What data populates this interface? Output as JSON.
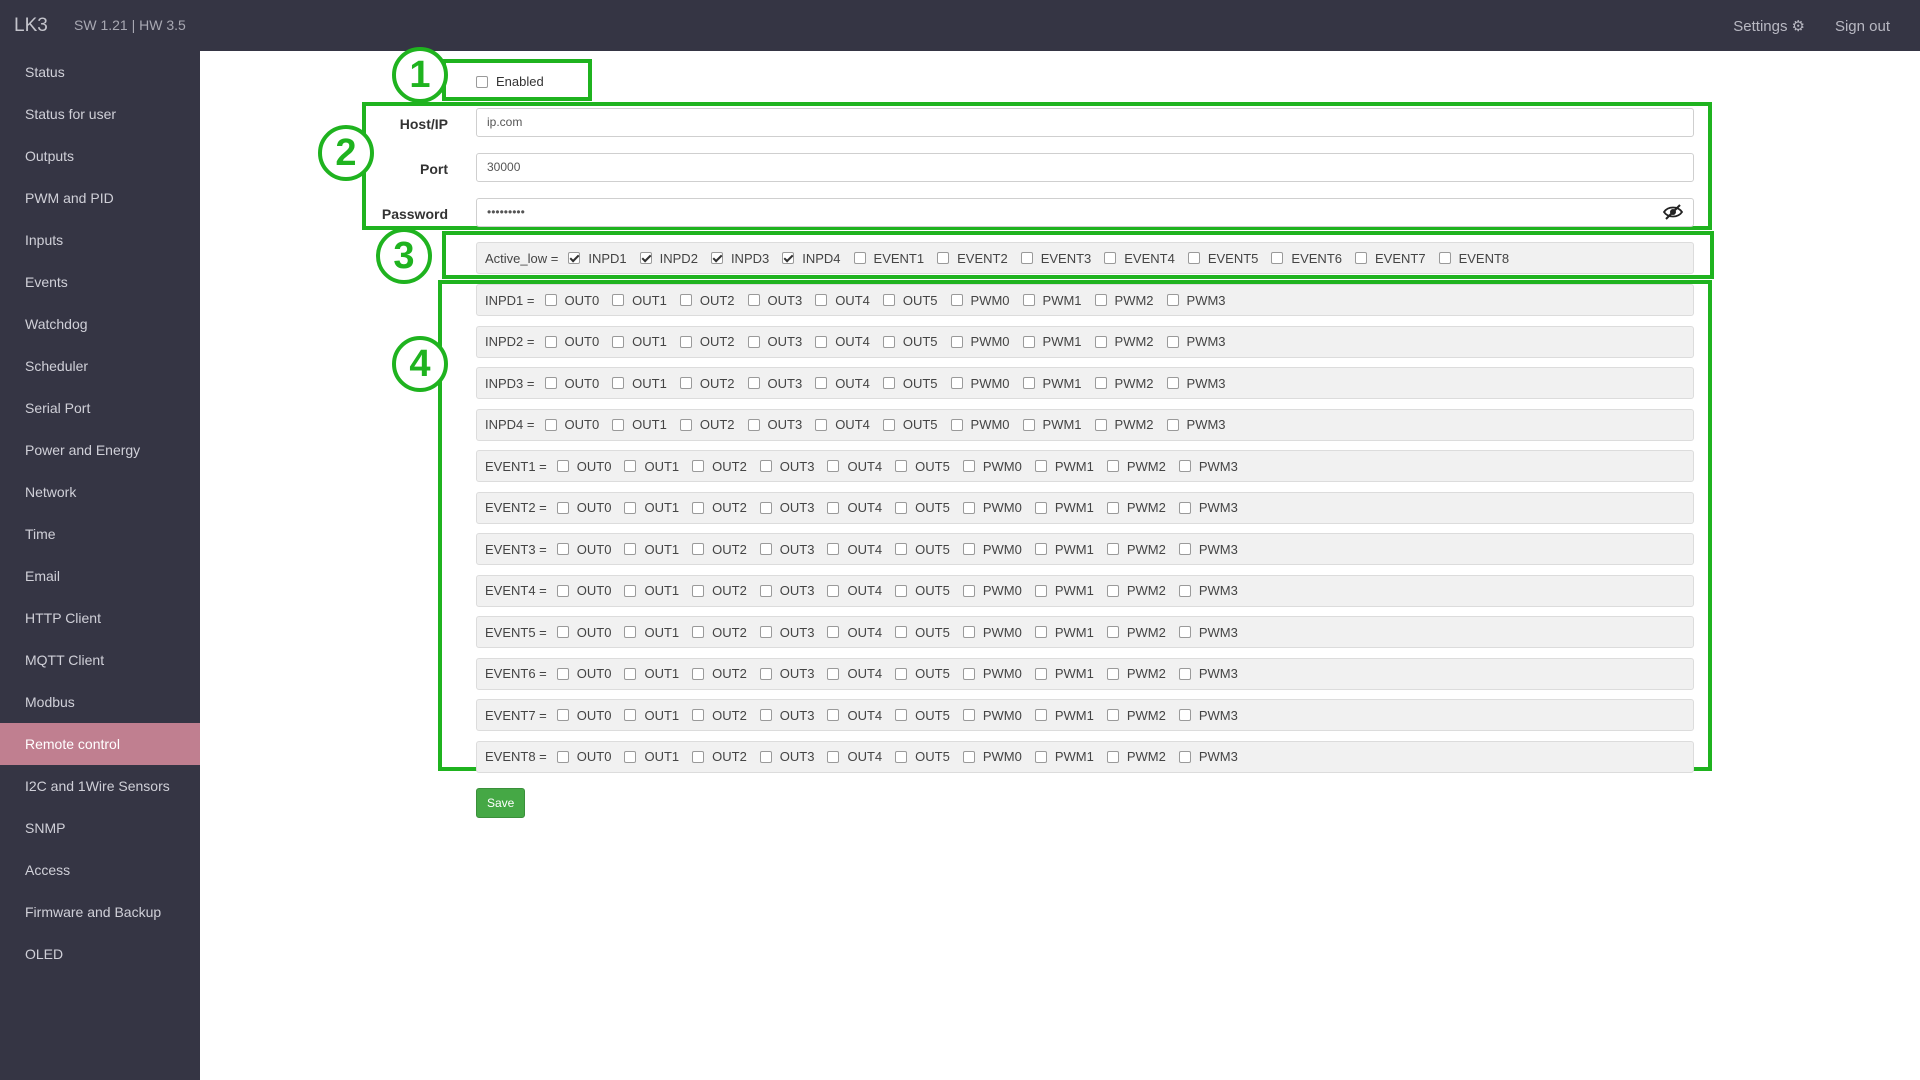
{
  "app": {
    "brand": "LK3",
    "version": "SW 1.21 | HW 3.5"
  },
  "topnav": {
    "settings": "Settings",
    "signout": "Sign out"
  },
  "sidebar": {
    "items": [
      {
        "label": "Status"
      },
      {
        "label": "Status for user"
      },
      {
        "label": "Outputs"
      },
      {
        "label": "PWM and PID"
      },
      {
        "label": "Inputs"
      },
      {
        "label": "Events"
      },
      {
        "label": "Watchdog"
      },
      {
        "label": "Scheduler"
      },
      {
        "label": "Serial Port"
      },
      {
        "label": "Power and Energy"
      },
      {
        "label": "Network"
      },
      {
        "label": "Time"
      },
      {
        "label": "Email"
      },
      {
        "label": "HTTP Client"
      },
      {
        "label": "MQTT Client"
      },
      {
        "label": "Modbus"
      },
      {
        "label": "Remote control",
        "active": true
      },
      {
        "label": "I2C and 1Wire Sensors"
      },
      {
        "label": "SNMP"
      },
      {
        "label": "Access"
      },
      {
        "label": "Firmware and Backup"
      },
      {
        "label": "OLED"
      }
    ]
  },
  "annotations": [
    "1",
    "2",
    "3",
    "4"
  ],
  "form": {
    "enabled": {
      "label": "Enabled",
      "checked": false
    },
    "host": {
      "label": "Host/IP",
      "value": "ip.com"
    },
    "port": {
      "label": "Port",
      "value": "30000"
    },
    "password": {
      "label": "Password",
      "value": "•••••••••"
    },
    "active_low": {
      "label": "Active_low =",
      "options": [
        {
          "label": "INPD1",
          "checked": true
        },
        {
          "label": "INPD2",
          "checked": true
        },
        {
          "label": "INPD3",
          "checked": true
        },
        {
          "label": "INPD4",
          "checked": true
        },
        {
          "label": "EVENT1",
          "checked": false
        },
        {
          "label": "EVENT2",
          "checked": false
        },
        {
          "label": "EVENT3",
          "checked": false
        },
        {
          "label": "EVENT4",
          "checked": false
        },
        {
          "label": "EVENT5",
          "checked": false
        },
        {
          "label": "EVENT6",
          "checked": false
        },
        {
          "label": "EVENT7",
          "checked": false
        },
        {
          "label": "EVENT8",
          "checked": false
        }
      ]
    },
    "mapping_outputs": [
      "OUT0",
      "OUT1",
      "OUT2",
      "OUT3",
      "OUT4",
      "OUT5",
      "PWM0",
      "PWM1",
      "PWM2",
      "PWM3"
    ],
    "mapping_rows": [
      "INPD1 =",
      "INPD2 =",
      "INPD3 =",
      "INPD4 =",
      "EVENT1 =",
      "EVENT2 =",
      "EVENT3 =",
      "EVENT4 =",
      "EVENT5 =",
      "EVENT6 =",
      "EVENT7 =",
      "EVENT8 ="
    ],
    "save_label": "Save"
  },
  "colors": {
    "annotation": "#1fb31f",
    "sidebar_bg": "#353544",
    "active_nav": "#c07f90",
    "save": "#45a845"
  }
}
